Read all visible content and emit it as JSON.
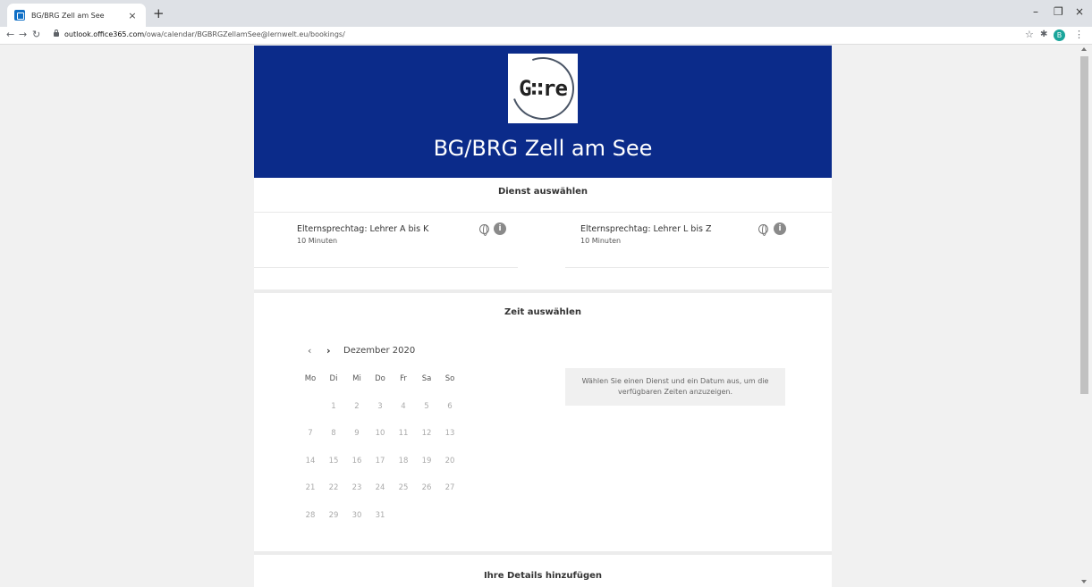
{
  "browser": {
    "tab_title": "BG/BRG Zell am See",
    "tab_close": "×",
    "new_tab": "+",
    "win_min": "–",
    "win_max": "❐",
    "win_close": "×",
    "url_host": "outlook.office365.com",
    "url_path": "/owa/calendar/BGBRGZellamSee@lernwelt.eu/bookings/",
    "profile_initial": "B",
    "icons": {
      "back": "arrow-left-icon",
      "forward": "arrow-right-icon",
      "reload": "reload-icon",
      "lock": "lock-icon",
      "star": "star-icon",
      "extensions": "puzzle-icon",
      "menu": "kebab-icon"
    }
  },
  "header": {
    "logo_text": "G∷re",
    "school_name": "BG/BRG Zell am See",
    "background": "#0b2b8a"
  },
  "service_section": {
    "title": "Dienst auswählen",
    "services": [
      {
        "name": "Elternsprechtag: Lehrer A bis K",
        "duration": "10 Minuten",
        "info": "i"
      },
      {
        "name": "Elternsprechtag: Lehrer L bis Z",
        "duration": "10 Minuten",
        "info": "i"
      }
    ]
  },
  "time_section": {
    "title": "Zeit auswählen",
    "prev": "‹",
    "next": "›",
    "month_label": "Dezember 2020",
    "weekdays": [
      "Mo",
      "Di",
      "Mi",
      "Do",
      "Fr",
      "Sa",
      "So"
    ],
    "weeks": [
      [
        "",
        "1",
        "2",
        "3",
        "4",
        "5",
        "6"
      ],
      [
        "7",
        "8",
        "9",
        "10",
        "11",
        "12",
        "13"
      ],
      [
        "14",
        "15",
        "16",
        "17",
        "18",
        "19",
        "20"
      ],
      [
        "21",
        "22",
        "23",
        "24",
        "25",
        "26",
        "27"
      ],
      [
        "28",
        "29",
        "30",
        "31",
        "",
        "",
        ""
      ]
    ],
    "hint": "Wählen Sie einen Dienst und ein Datum aus, um die verfügbaren Zeiten anzuzeigen."
  },
  "details_section": {
    "title": "Ihre Details hinzufügen"
  }
}
